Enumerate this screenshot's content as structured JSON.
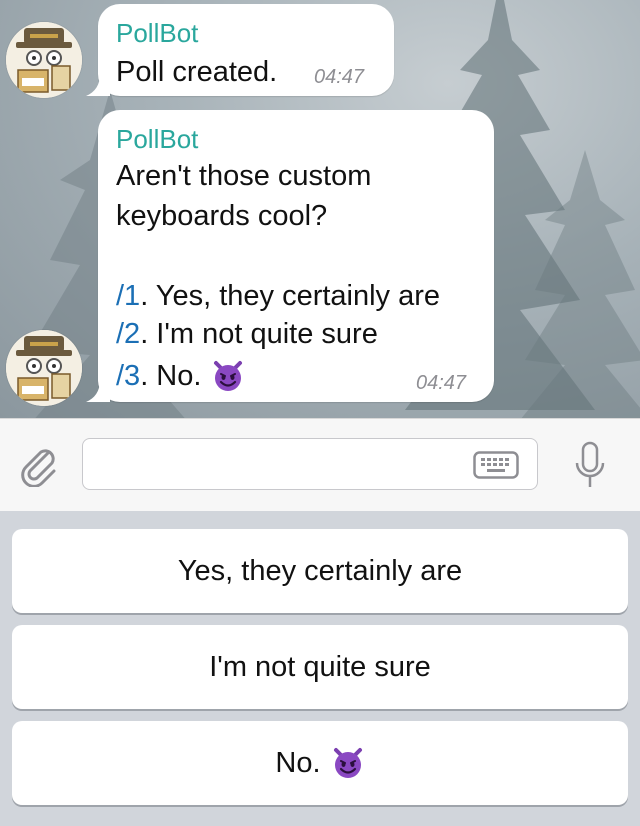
{
  "messages": [
    {
      "sender": "PollBot",
      "text": "Poll created.",
      "time": "04:47"
    },
    {
      "sender": "PollBot",
      "question_line1": "Aren't those custom",
      "question_line2": "keyboards cool?",
      "options": [
        {
          "command": "/1",
          "text": ". Yes, they certainly are"
        },
        {
          "command": "/2",
          "text": ". I'm not quite sure"
        },
        {
          "command": "/3",
          "text": ". No."
        }
      ],
      "time": "04:47"
    }
  ],
  "input": {
    "placeholder": ""
  },
  "keyboard": {
    "buttons": [
      {
        "label": "Yes, they certainly are"
      },
      {
        "label": "I'm not quite sure"
      },
      {
        "label": "No.",
        "emoji": "smiling-imp-emoji"
      }
    ]
  },
  "colors": {
    "sender": "#2aa79d",
    "command": "#1b6fb5",
    "emoji": "#7b3fb0"
  }
}
